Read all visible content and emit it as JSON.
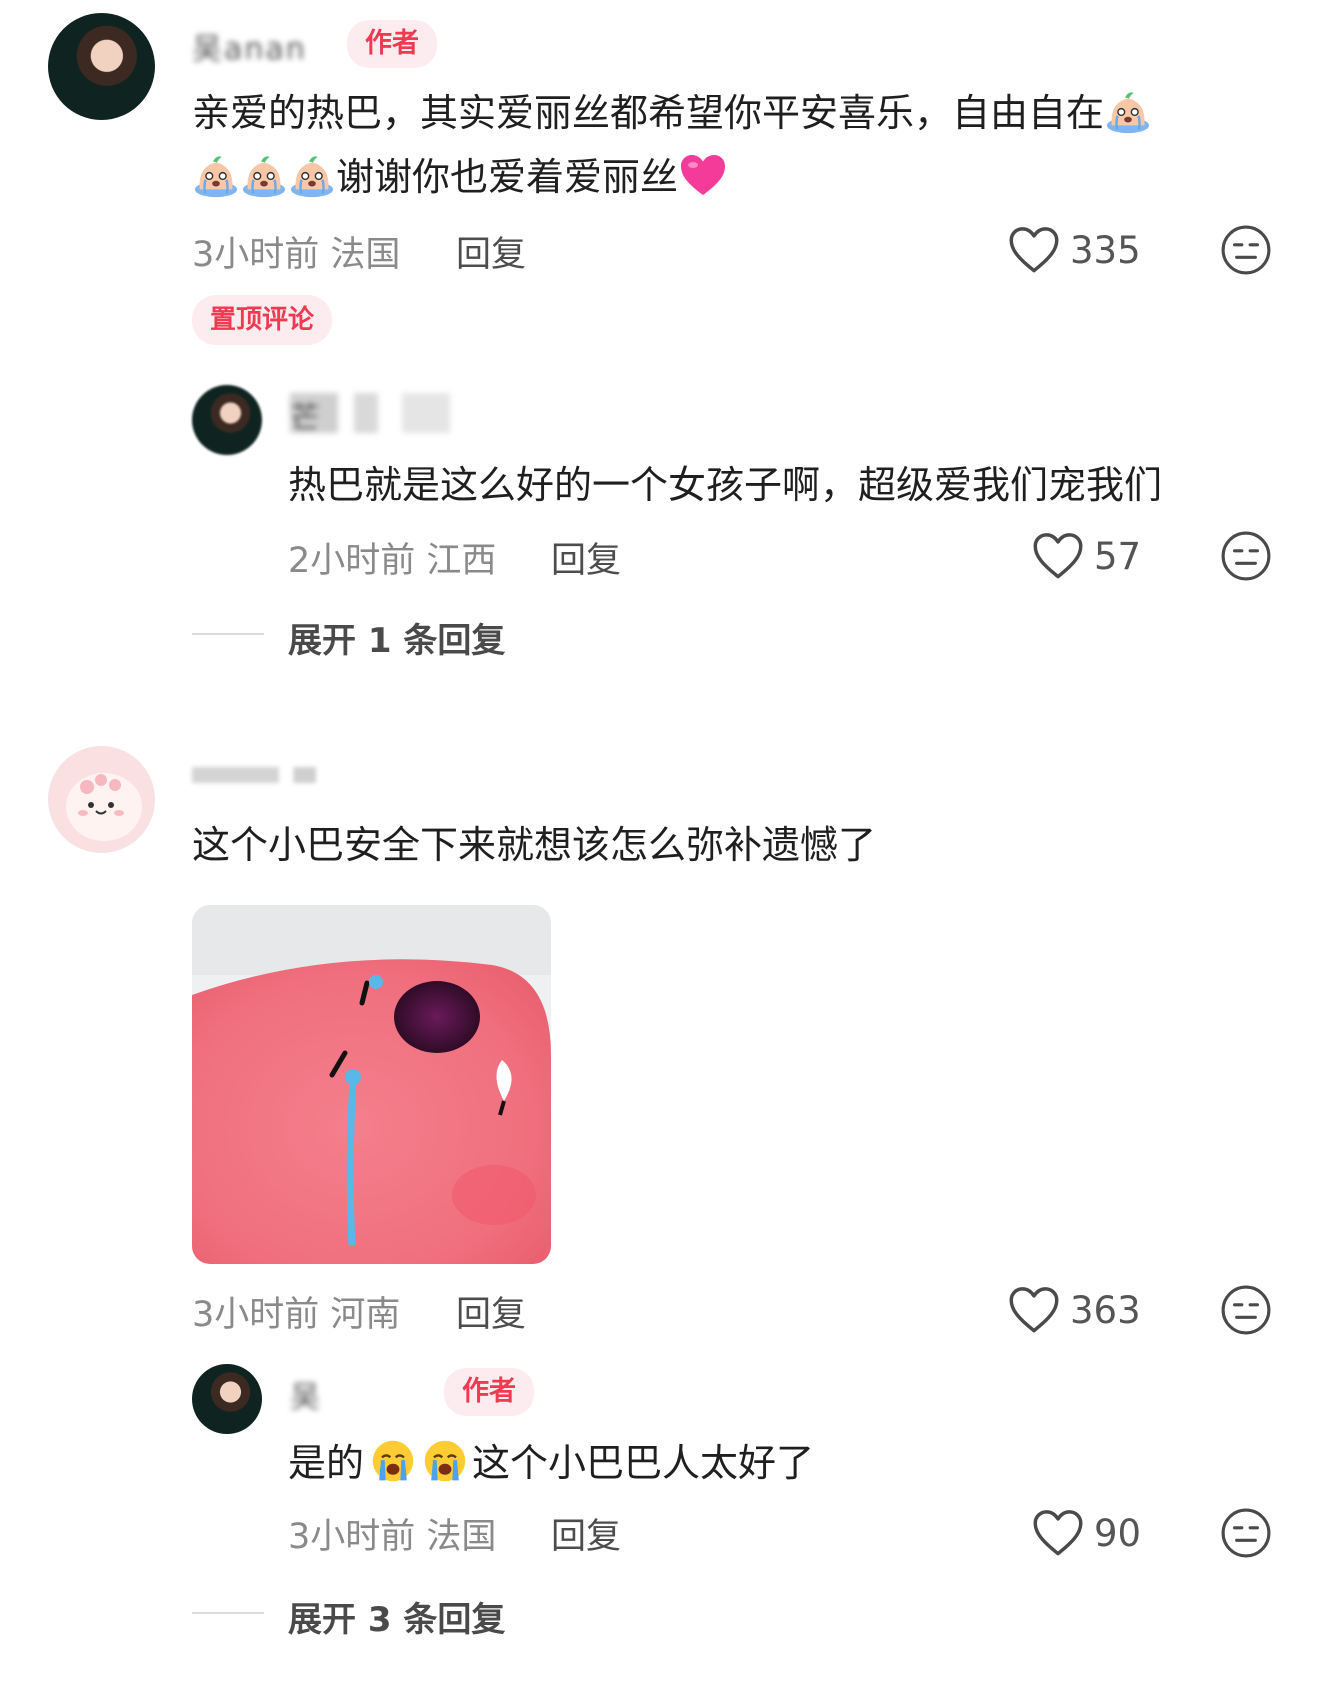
{
  "colors": {
    "accent_red": "#ef3a52",
    "tag_background": "#fdecef",
    "meta_gray": "#8a8a8a",
    "divider": "#dcdcdc"
  },
  "comments": [
    {
      "username": "吴anan",
      "author_tag": "作者",
      "text_line1": "亲爱的热巴，其实爱丽丝都希望你平安喜乐，自由自在",
      "text_line2": "谢谢你也爱着爱丽丝",
      "time": "3小时前",
      "location": "法国",
      "reply_label": "回复",
      "likes": "335",
      "pinned_label": "置顶评论",
      "replies": [
        {
          "username": "芒",
          "text": "热巴就是这么好的一个女孩子啊，超级爱我们宠我们",
          "time": "2小时前",
          "location": "江西",
          "reply_label": "回复",
          "likes": "57"
        }
      ],
      "expand_label": "展开 1 条回复"
    },
    {
      "username": "",
      "text": "这个小巴安全下来就想该怎么弥补遗憾了",
      "time": "3小时前",
      "location": "河南",
      "reply_label": "回复",
      "likes": "363",
      "replies": [
        {
          "username": "吴",
          "author_tag": "作者",
          "text_start": "是的",
          "text_end": "这个小巴巴人太好了",
          "time": "3小时前",
          "location": "法国",
          "reply_label": "回复",
          "likes": "90"
        }
      ],
      "expand_label": "展开 3 条回复"
    }
  ],
  "icons": {
    "like": "heart-outline-icon",
    "dislike": "neutral-face-icon",
    "crying_emoji": "crying-peach-emoji",
    "love_emoji": "pink-heart-emoji",
    "sob_emoji": "loudly-crying-face-emoji"
  }
}
